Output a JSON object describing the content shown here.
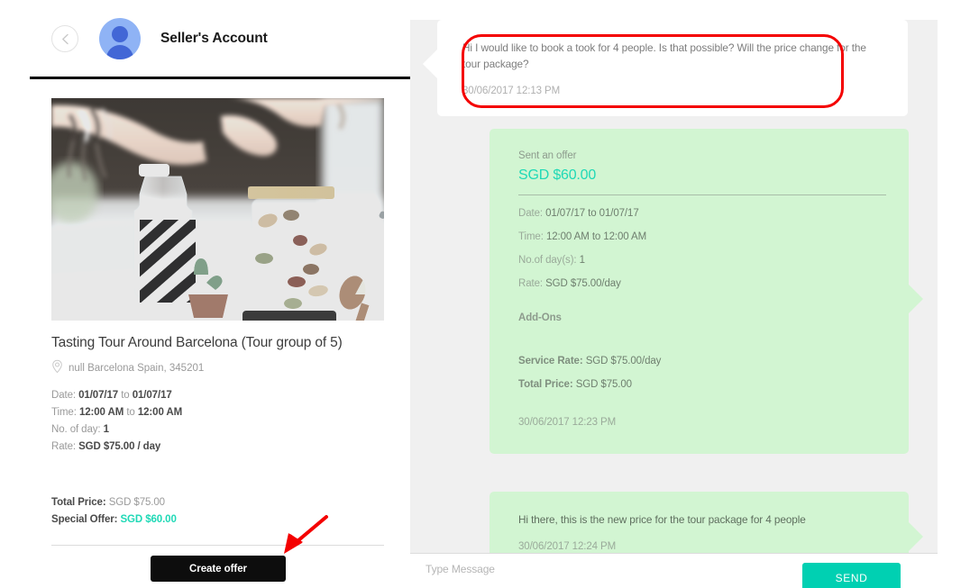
{
  "header": {
    "back_icon": "chevron-left-icon",
    "avatar_icon": "user-avatar-icon",
    "title": "Seller's Account"
  },
  "listing": {
    "photo_alt": "desk-with-bottle-and-jar-photo",
    "title": "Tasting Tour Around Barcelona (Tour group of 5)",
    "location_icon": "map-pin-icon",
    "location": "null Barcelona Spain, 345201",
    "date_label": "Date:",
    "date_from": "01/07/17",
    "date_sep": "to",
    "date_to": "01/07/17",
    "time_label": "Time:",
    "time_from": "12:00 AM",
    "time_sep": "to",
    "time_to": "12:00 AM",
    "days_label": "No. of day:",
    "days_value": "1",
    "rate_label": "Rate:",
    "rate_value": "SGD $75.00 / day",
    "total_price_label": "Total Price:",
    "total_price_value": "SGD $75.00",
    "special_offer_label": "Special Offer:",
    "special_offer_value": "SGD $60.00",
    "create_offer_label": "Create offer"
  },
  "chat": {
    "incoming": {
      "text": "Hi I would like to book a took for 4 people. Is that possible? Will the price change for the tour package?",
      "time": "30/06/2017 12:13 PM"
    },
    "offer": {
      "sent_label": "Sent an offer",
      "amount": "SGD $60.00",
      "date_label": "Date:",
      "date_value": "01/07/17 to 01/07/17",
      "time_label": "Time:",
      "time_value": "12:00 AM to 12:00 AM",
      "days_label": "No.of day(s):",
      "days_value": "1",
      "rate_label": "Rate:",
      "rate_value": "SGD $75.00/day",
      "addons_label": "Add-Ons",
      "service_rate_label": "Service Rate:",
      "service_rate_value": "SGD $75.00/day",
      "total_price_label": "Total Price:",
      "total_price_value": "SGD $75.00",
      "time_stamp": "30/06/2017 12:23 PM"
    },
    "reply": {
      "text": "Hi there, this is the new price for the tour package for 4 people",
      "time": "30/06/2017 12:24 PM"
    }
  },
  "composer": {
    "placeholder": "Type Message",
    "value": "",
    "send_label": "SEND"
  },
  "annotations": {
    "highlight_shape": "red-rounded-rectangle",
    "arrow_shape": "red-arrow-pointing-to-create-offer"
  },
  "colors": {
    "accent_teal": "#1fd9b6",
    "send_teal": "#00d0b2",
    "bubble_green": "#d2f5d2",
    "panel_gray": "#f0f0f0",
    "annotation_red": "#f40000",
    "button_black": "#0d0d0d",
    "avatar_blue": "#8fb3f5"
  }
}
